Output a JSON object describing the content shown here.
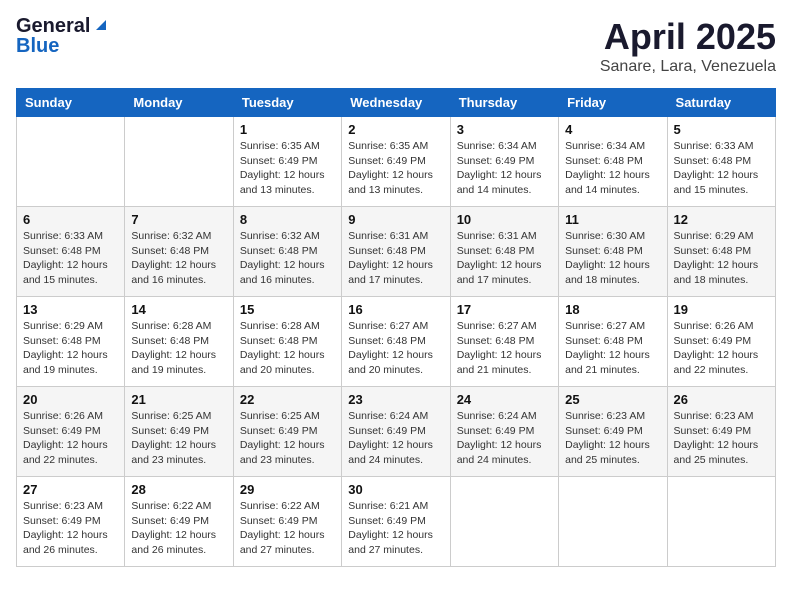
{
  "header": {
    "logo_general": "General",
    "logo_blue": "Blue",
    "title": "April 2025",
    "location": "Sanare, Lara, Venezuela"
  },
  "days_of_week": [
    "Sunday",
    "Monday",
    "Tuesday",
    "Wednesday",
    "Thursday",
    "Friday",
    "Saturday"
  ],
  "weeks": [
    [
      {
        "num": "",
        "sunrise": "",
        "sunset": "",
        "daylight": ""
      },
      {
        "num": "",
        "sunrise": "",
        "sunset": "",
        "daylight": ""
      },
      {
        "num": "1",
        "sunrise": "Sunrise: 6:35 AM",
        "sunset": "Sunset: 6:49 PM",
        "daylight": "Daylight: 12 hours and 13 minutes."
      },
      {
        "num": "2",
        "sunrise": "Sunrise: 6:35 AM",
        "sunset": "Sunset: 6:49 PM",
        "daylight": "Daylight: 12 hours and 13 minutes."
      },
      {
        "num": "3",
        "sunrise": "Sunrise: 6:34 AM",
        "sunset": "Sunset: 6:49 PM",
        "daylight": "Daylight: 12 hours and 14 minutes."
      },
      {
        "num": "4",
        "sunrise": "Sunrise: 6:34 AM",
        "sunset": "Sunset: 6:48 PM",
        "daylight": "Daylight: 12 hours and 14 minutes."
      },
      {
        "num": "5",
        "sunrise": "Sunrise: 6:33 AM",
        "sunset": "Sunset: 6:48 PM",
        "daylight": "Daylight: 12 hours and 15 minutes."
      }
    ],
    [
      {
        "num": "6",
        "sunrise": "Sunrise: 6:33 AM",
        "sunset": "Sunset: 6:48 PM",
        "daylight": "Daylight: 12 hours and 15 minutes."
      },
      {
        "num": "7",
        "sunrise": "Sunrise: 6:32 AM",
        "sunset": "Sunset: 6:48 PM",
        "daylight": "Daylight: 12 hours and 16 minutes."
      },
      {
        "num": "8",
        "sunrise": "Sunrise: 6:32 AM",
        "sunset": "Sunset: 6:48 PM",
        "daylight": "Daylight: 12 hours and 16 minutes."
      },
      {
        "num": "9",
        "sunrise": "Sunrise: 6:31 AM",
        "sunset": "Sunset: 6:48 PM",
        "daylight": "Daylight: 12 hours and 17 minutes."
      },
      {
        "num": "10",
        "sunrise": "Sunrise: 6:31 AM",
        "sunset": "Sunset: 6:48 PM",
        "daylight": "Daylight: 12 hours and 17 minutes."
      },
      {
        "num": "11",
        "sunrise": "Sunrise: 6:30 AM",
        "sunset": "Sunset: 6:48 PM",
        "daylight": "Daylight: 12 hours and 18 minutes."
      },
      {
        "num": "12",
        "sunrise": "Sunrise: 6:29 AM",
        "sunset": "Sunset: 6:48 PM",
        "daylight": "Daylight: 12 hours and 18 minutes."
      }
    ],
    [
      {
        "num": "13",
        "sunrise": "Sunrise: 6:29 AM",
        "sunset": "Sunset: 6:48 PM",
        "daylight": "Daylight: 12 hours and 19 minutes."
      },
      {
        "num": "14",
        "sunrise": "Sunrise: 6:28 AM",
        "sunset": "Sunset: 6:48 PM",
        "daylight": "Daylight: 12 hours and 19 minutes."
      },
      {
        "num": "15",
        "sunrise": "Sunrise: 6:28 AM",
        "sunset": "Sunset: 6:48 PM",
        "daylight": "Daylight: 12 hours and 20 minutes."
      },
      {
        "num": "16",
        "sunrise": "Sunrise: 6:27 AM",
        "sunset": "Sunset: 6:48 PM",
        "daylight": "Daylight: 12 hours and 20 minutes."
      },
      {
        "num": "17",
        "sunrise": "Sunrise: 6:27 AM",
        "sunset": "Sunset: 6:48 PM",
        "daylight": "Daylight: 12 hours and 21 minutes."
      },
      {
        "num": "18",
        "sunrise": "Sunrise: 6:27 AM",
        "sunset": "Sunset: 6:48 PM",
        "daylight": "Daylight: 12 hours and 21 minutes."
      },
      {
        "num": "19",
        "sunrise": "Sunrise: 6:26 AM",
        "sunset": "Sunset: 6:49 PM",
        "daylight": "Daylight: 12 hours and 22 minutes."
      }
    ],
    [
      {
        "num": "20",
        "sunrise": "Sunrise: 6:26 AM",
        "sunset": "Sunset: 6:49 PM",
        "daylight": "Daylight: 12 hours and 22 minutes."
      },
      {
        "num": "21",
        "sunrise": "Sunrise: 6:25 AM",
        "sunset": "Sunset: 6:49 PM",
        "daylight": "Daylight: 12 hours and 23 minutes."
      },
      {
        "num": "22",
        "sunrise": "Sunrise: 6:25 AM",
        "sunset": "Sunset: 6:49 PM",
        "daylight": "Daylight: 12 hours and 23 minutes."
      },
      {
        "num": "23",
        "sunrise": "Sunrise: 6:24 AM",
        "sunset": "Sunset: 6:49 PM",
        "daylight": "Daylight: 12 hours and 24 minutes."
      },
      {
        "num": "24",
        "sunrise": "Sunrise: 6:24 AM",
        "sunset": "Sunset: 6:49 PM",
        "daylight": "Daylight: 12 hours and 24 minutes."
      },
      {
        "num": "25",
        "sunrise": "Sunrise: 6:23 AM",
        "sunset": "Sunset: 6:49 PM",
        "daylight": "Daylight: 12 hours and 25 minutes."
      },
      {
        "num": "26",
        "sunrise": "Sunrise: 6:23 AM",
        "sunset": "Sunset: 6:49 PM",
        "daylight": "Daylight: 12 hours and 25 minutes."
      }
    ],
    [
      {
        "num": "27",
        "sunrise": "Sunrise: 6:23 AM",
        "sunset": "Sunset: 6:49 PM",
        "daylight": "Daylight: 12 hours and 26 minutes."
      },
      {
        "num": "28",
        "sunrise": "Sunrise: 6:22 AM",
        "sunset": "Sunset: 6:49 PM",
        "daylight": "Daylight: 12 hours and 26 minutes."
      },
      {
        "num": "29",
        "sunrise": "Sunrise: 6:22 AM",
        "sunset": "Sunset: 6:49 PM",
        "daylight": "Daylight: 12 hours and 27 minutes."
      },
      {
        "num": "30",
        "sunrise": "Sunrise: 6:21 AM",
        "sunset": "Sunset: 6:49 PM",
        "daylight": "Daylight: 12 hours and 27 minutes."
      },
      {
        "num": "",
        "sunrise": "",
        "sunset": "",
        "daylight": ""
      },
      {
        "num": "",
        "sunrise": "",
        "sunset": "",
        "daylight": ""
      },
      {
        "num": "",
        "sunrise": "",
        "sunset": "",
        "daylight": ""
      }
    ]
  ]
}
